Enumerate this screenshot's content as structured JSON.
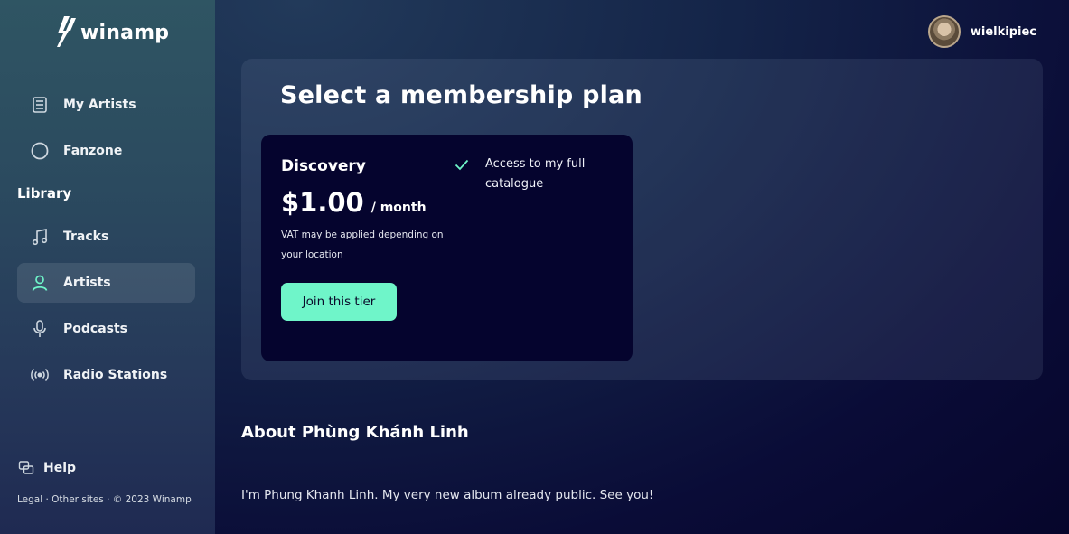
{
  "app": {
    "logo_text": "winamp"
  },
  "sidebar": {
    "top_items": [
      {
        "label": "My Artists",
        "icon": "vinyl-stack-icon"
      },
      {
        "label": "Fanzone",
        "icon": "circle-icon"
      }
    ],
    "library_heading": "Library",
    "library_items": [
      {
        "label": "Tracks",
        "icon": "music-note-icon"
      },
      {
        "label": "Artists",
        "icon": "user-icon",
        "active": true
      },
      {
        "label": "Podcasts",
        "icon": "microphone-icon"
      },
      {
        "label": "Radio Stations",
        "icon": "radio-waves-icon"
      }
    ],
    "help_label": "Help",
    "footer": {
      "legal": "Legal",
      "other_sites": "Other sites",
      "copyright": "© 2023 Winamp",
      "separator": " · "
    }
  },
  "header": {
    "username": "wielkipiec"
  },
  "plans": {
    "title": "Select a membership plan",
    "card": {
      "name": "Discovery",
      "price": "$1.00",
      "period": "/ month",
      "note": "VAT may be applied depending on your location",
      "button_label": "Join this tier",
      "features": [
        "Access to my full catalogue"
      ]
    }
  },
  "about": {
    "title": "About Phùng Khánh Linh",
    "text": "I'm Phung Khanh Linh. My very new album already public. See you!"
  },
  "colors": {
    "accent": "#6ff5c9",
    "card_bg": "#05042e",
    "page_bg": "#06052b"
  }
}
